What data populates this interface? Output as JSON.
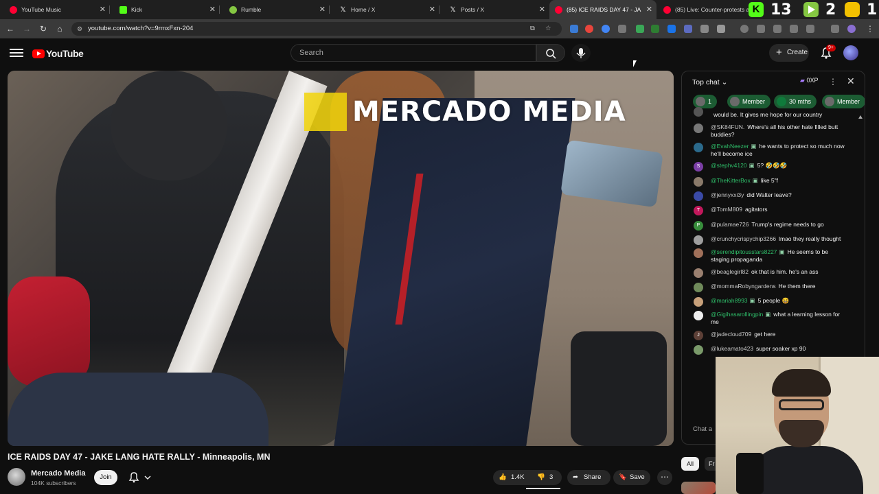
{
  "browser": {
    "tabs": [
      {
        "title": "YouTube Music",
        "color": "#ff0033"
      },
      {
        "title": "Kick",
        "color": "#53fc18"
      },
      {
        "title": "Rumble",
        "color": "#85c742"
      },
      {
        "title": "Home / X",
        "color": "#ffffff"
      },
      {
        "title": "Posts / X",
        "color": "#ffffff"
      },
      {
        "title": "(85) ICE RAIDS DAY 47 - JA",
        "color": "#ff0033",
        "active": true
      },
      {
        "title": "(85) Live: Counter-protests an",
        "color": "#ff0033"
      }
    ],
    "url": "youtube.com/watch?v=9rmxFxn-204",
    "overlay_counters": [
      "13",
      "2",
      "1"
    ]
  },
  "header": {
    "logo_text": "YouTube",
    "search_placeholder": "Search",
    "create_label": "Create",
    "notification_count": "9+"
  },
  "video": {
    "watermark": "MERCADO MEDIA",
    "title": "ICE RAIDS DAY 47 - JAKE LANG HATE RALLY - Minneapolis, MN"
  },
  "channel": {
    "name": "Mercado Media",
    "subscribers": "104K subscribers",
    "join_label": "Join"
  },
  "actions": {
    "likes": "1.4K",
    "dislikes": "3",
    "share_label": "Share",
    "save_label": "Save"
  },
  "chat": {
    "header_label": "Top chat",
    "xp_label": "0XP",
    "chips": [
      {
        "label": "1"
      },
      {
        "label": "Member"
      },
      {
        "label": "30 mths"
      },
      {
        "label": "Member"
      }
    ],
    "messages": [
      {
        "author": "",
        "text": "would be. It gives me hope for our country",
        "member": false,
        "initial": "",
        "color": "#555555"
      },
      {
        "author": "@SK84FUN.",
        "text": "Where's all his other hate filled butt buddies?",
        "member": false,
        "initial": "",
        "color": "#777777"
      },
      {
        "author": "@EvahNeezer",
        "text": "he wants to protect so much now he'll become ice",
        "member": true,
        "initial": "",
        "color": "#2b6a8c"
      },
      {
        "author": "@stephv4120",
        "text": "5? 🤣🤣🤣",
        "member": true,
        "initial": "S",
        "color": "#7b3fa6"
      },
      {
        "author": "@TheKitterBox",
        "text": "like 5\"f",
        "member": true,
        "initial": "",
        "color": "#8a7a6a"
      },
      {
        "author": "@jennyxxi3y",
        "text": "did Walter leave?",
        "member": false,
        "initial": "",
        "color": "#3a4aa6"
      },
      {
        "author": "@TomM809",
        "text": "agitators",
        "member": false,
        "initial": "T",
        "color": "#c2185b"
      },
      {
        "author": "@pulamae726",
        "text": "Trump's regime needs to go",
        "member": false,
        "initial": "P",
        "color": "#388e3c"
      },
      {
        "author": "@crunchycrispychip3266",
        "text": "lmao they really thought",
        "member": false,
        "initial": "",
        "color": "#9e9e9e"
      },
      {
        "author": "@serendipitousstars8227",
        "text": "He seems to be staging propaganda",
        "member": true,
        "initial": "",
        "color": "#a0705a"
      },
      {
        "author": "@beaglegirl82",
        "text": "ok that is him. he's an ass",
        "member": false,
        "initial": "",
        "color": "#9a8070"
      },
      {
        "author": "@mommaRobyngardens",
        "text": "He them there",
        "member": false,
        "initial": "",
        "color": "#6f8a5a"
      },
      {
        "author": "@mariah8993",
        "text": "5 people 😆",
        "member": true,
        "initial": "",
        "color": "#c7a07a"
      },
      {
        "author": "@Gigihasarollingpin",
        "text": "what a learning lesson for me",
        "member": true,
        "initial": "",
        "color": "#eeeeee"
      },
      {
        "author": "@jadecloud709",
        "text": "get here",
        "member": false,
        "initial": "J",
        "color": "#5d4037"
      },
      {
        "author": "@lukeamato423",
        "text": "super soaker xp 90",
        "member": false,
        "initial": "",
        "color": "#7a9a6a"
      }
    ],
    "input_placeholder": "Chat a"
  },
  "below": {
    "filter_all": "All",
    "filter_second": "Fr"
  }
}
